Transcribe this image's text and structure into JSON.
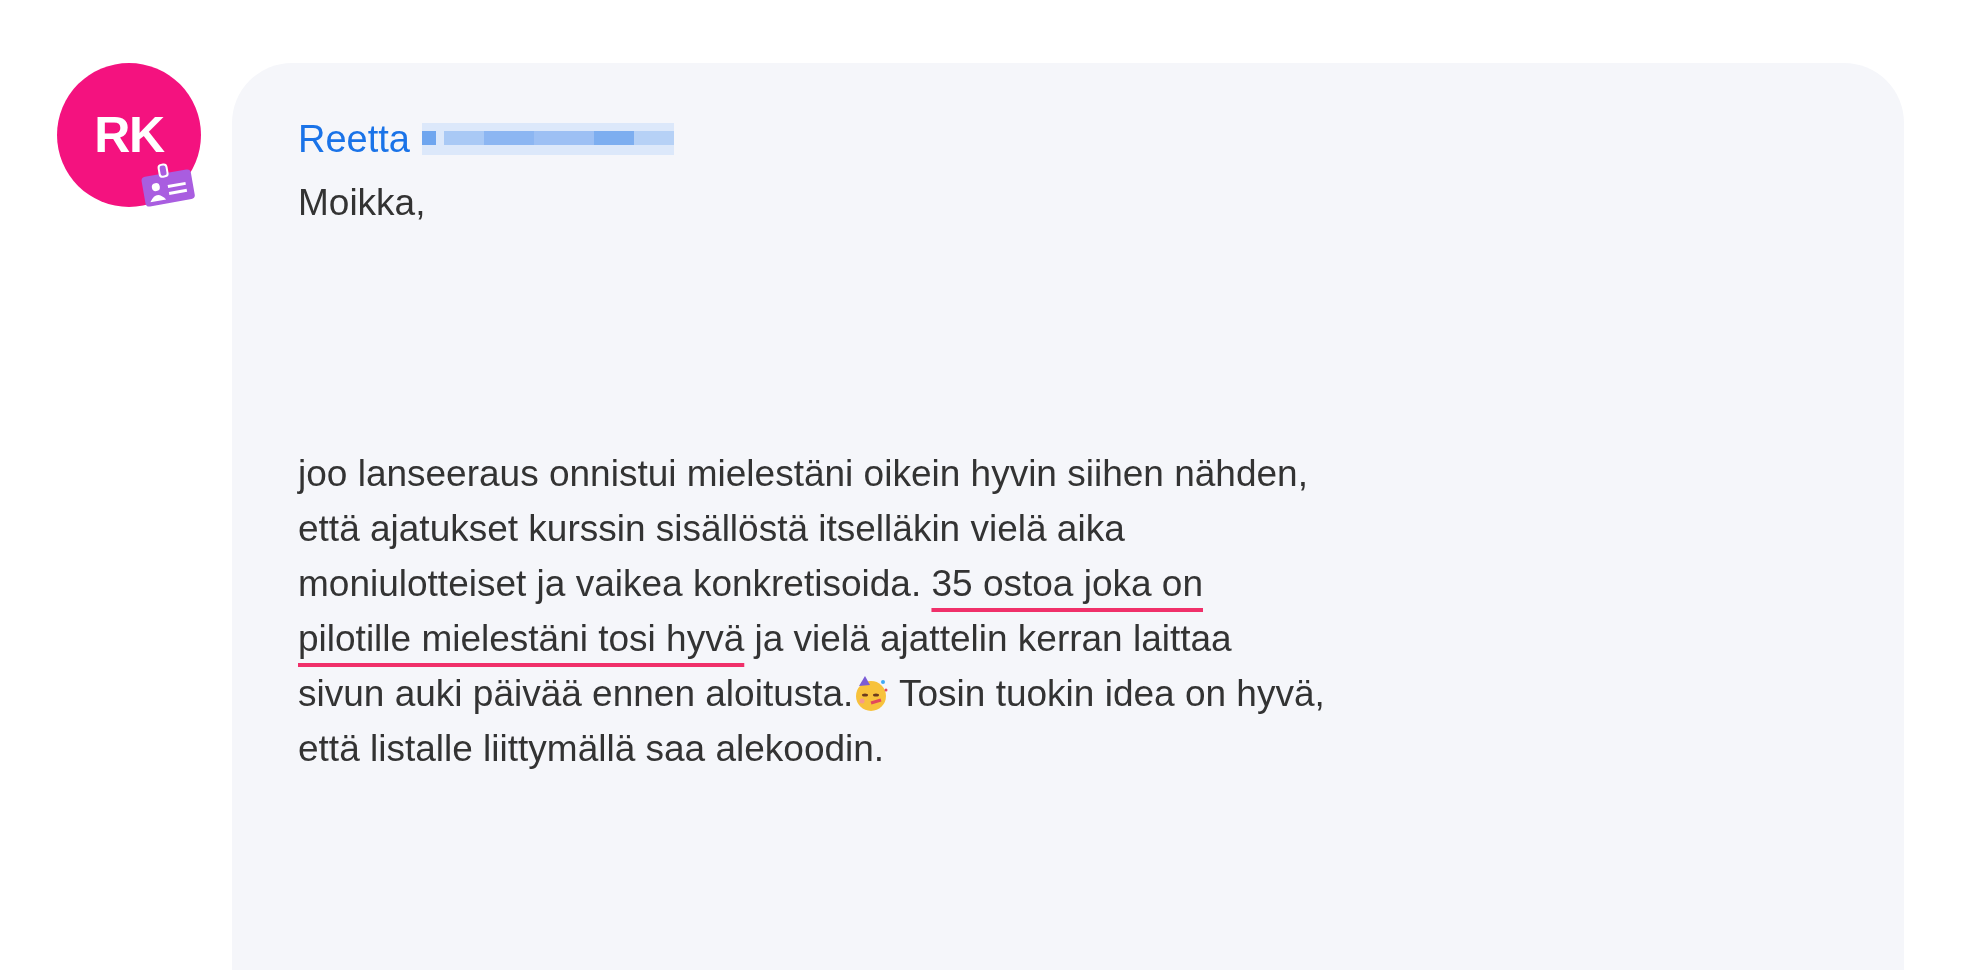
{
  "message": {
    "avatar": {
      "initials": "RK"
    },
    "sender": "Reetta",
    "greeting": "Moikka,",
    "body": [
      {
        "kind": "text",
        "text": "joo lanseeraus onnistui mielestäni oikein hyvin siihen nähden,\nettä ajatukset kurssin sisällöstä itselläkin vielä aika\nmoniulotteiset ja vaikea konkretisoida. "
      },
      {
        "kind": "underlined",
        "text": "35 ostoa joka on\npilotille mielestäni tosi hyvä"
      },
      {
        "kind": "text",
        "text": " ja vielä ajattelin kerran laittaa\nsivun auki päivää ennen aloitusta."
      },
      {
        "kind": "emoji"
      },
      {
        "kind": "text",
        "text": " Tosin tuokin idea on hyvä,\nettä listalle liittymällä saa alekoodin."
      }
    ]
  }
}
